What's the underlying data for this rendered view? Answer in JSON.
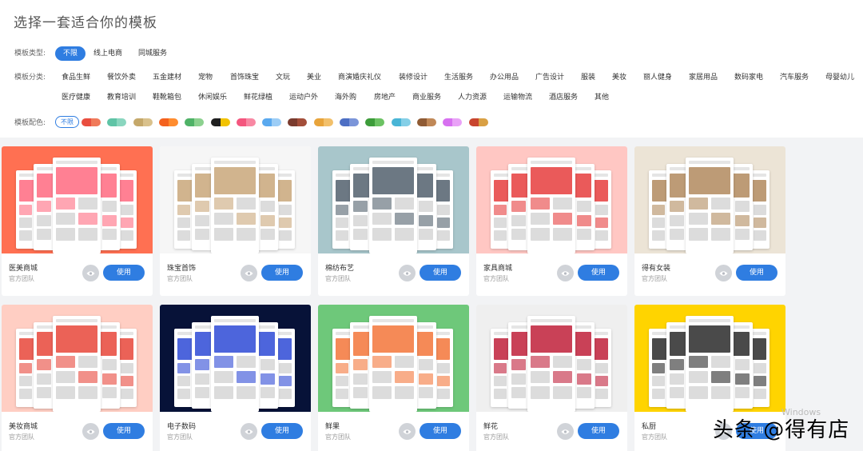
{
  "page_title": "选择一套适合你的模板",
  "filters": {
    "type": {
      "label": "模板类型:",
      "options": [
        "不限",
        "线上电商",
        "同城服务"
      ]
    },
    "category": {
      "label": "模板分类:",
      "row1": [
        "食品生鲜",
        "餐饮外卖",
        "五金建材",
        "宠物",
        "首饰珠宝",
        "文玩",
        "美业",
        "商演婚庆礼仪",
        "装修设计",
        "生活服务",
        "办公用品",
        "广告设计",
        "服装",
        "美妆",
        "丽人健身",
        "家居用品",
        "数码家电",
        "汽车服务",
        "母婴幼儿"
      ],
      "row2": [
        "医疗健康",
        "教育培训",
        "鞋靴箱包",
        "休闲娱乐",
        "鲜花绿植",
        "运动户外",
        "海外购",
        "房地产",
        "商业服务",
        "人力资源",
        "运输物流",
        "酒店服务",
        "其他"
      ]
    },
    "color": {
      "label": "模板配色:",
      "all": "不限",
      "swatches": [
        [
          "#e94e3f",
          "#f07a5a"
        ],
        [
          "#5fc4a6",
          "#8ad6bf"
        ],
        [
          "#c5a86a",
          "#d9c18c"
        ],
        [
          "#f4621e",
          "#ff8c2f"
        ],
        [
          "#4fb267",
          "#8cd18f"
        ],
        [
          "#1f1f1f",
          "#f2c200"
        ],
        [
          "#f4567e",
          "#f888a3"
        ],
        [
          "#5aa9ef",
          "#9ccdf6"
        ],
        [
          "#7a3b2e",
          "#a34e3a"
        ],
        [
          "#e8a43b",
          "#f2c06b"
        ],
        [
          "#4d6fc4",
          "#7b95d9"
        ],
        [
          "#3d9c3a",
          "#6cc263"
        ],
        [
          "#49b5d6",
          "#84cfe7"
        ],
        [
          "#8f5b34",
          "#c08857"
        ],
        [
          "#d770f0",
          "#e9a2f7"
        ],
        [
          "#c8452e",
          "#d9a044"
        ]
      ]
    }
  },
  "templates": [
    {
      "name": "医美商城",
      "author": "官方团队",
      "bg": "#ff7052",
      "accent": "#ff6a80"
    },
    {
      "name": "珠宝首饰",
      "author": "官方团队",
      "bg": "#f6f6f6",
      "accent": "#c9a77a"
    },
    {
      "name": "棉纺布艺",
      "author": "官方团队",
      "bg": "#a8c6cb",
      "accent": "#52606d"
    },
    {
      "name": "家具商城",
      "author": "官方团队",
      "bg": "#ffc7c3",
      "accent": "#e63d3d"
    },
    {
      "name": "得有女装",
      "author": "官方团队",
      "bg": "#ece4d6",
      "accent": "#b18a5e"
    },
    {
      "name": "美妆商城",
      "author": "官方团队",
      "bg": "#ffcec3",
      "accent": "#e8463a"
    },
    {
      "name": "电子数码",
      "author": "官方团队",
      "bg": "#071238",
      "accent": "#2e4ad6"
    },
    {
      "name": "鲜果",
      "author": "官方团队",
      "bg": "#6ec87a",
      "accent": "#f3763a"
    },
    {
      "name": "鲜花",
      "author": "官方团队",
      "bg": "#efefef",
      "accent": "#c0203a"
    },
    {
      "name": "私厨",
      "author": "官方团队",
      "bg": "#ffd400",
      "accent": "#2a2a2a"
    }
  ],
  "actions": {
    "use_label": "使用",
    "preview_icon": "eye-icon"
  },
  "watermark": {
    "text": "头条 @得有店",
    "sub": "Windows"
  }
}
